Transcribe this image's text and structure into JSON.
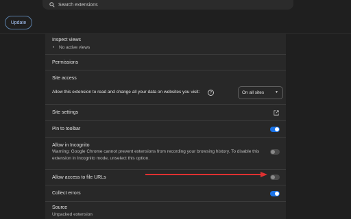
{
  "search": {
    "placeholder": "Search extensions",
    "icon": "search-icon"
  },
  "toolbar": {
    "update_label": "Update"
  },
  "settings": {
    "inspect_views": {
      "title": "Inspect views",
      "bullet": "•",
      "value": "No active views"
    },
    "permissions": {
      "title": "Permissions"
    },
    "site_access": {
      "title": "Site access",
      "description": "Allow this extension to read and change all your data on websites you visit:",
      "help_icon": "?",
      "dropdown_value": "On all sites",
      "dropdown_caret": "▼"
    },
    "site_settings": {
      "title": "Site settings",
      "icon": "external-link-icon"
    },
    "pin_to_toolbar": {
      "title": "Pin to toolbar",
      "enabled": true
    },
    "incognito": {
      "title": "Allow in Incognito",
      "warning": "Warning: Google Chrome cannot prevent extensions from recording your browsing history. To disable this extension in Incognito mode, unselect this option.",
      "enabled": false
    },
    "file_urls": {
      "title": "Allow access to file URLs",
      "enabled": false
    },
    "collect_errors": {
      "title": "Collect errors",
      "enabled": true
    },
    "source": {
      "title": "Source",
      "value": "Unpacked extension"
    }
  },
  "colors": {
    "background": "#1f1f1f",
    "card": "#282828",
    "accent": "#1a73e8",
    "arrow": "#e03131"
  }
}
